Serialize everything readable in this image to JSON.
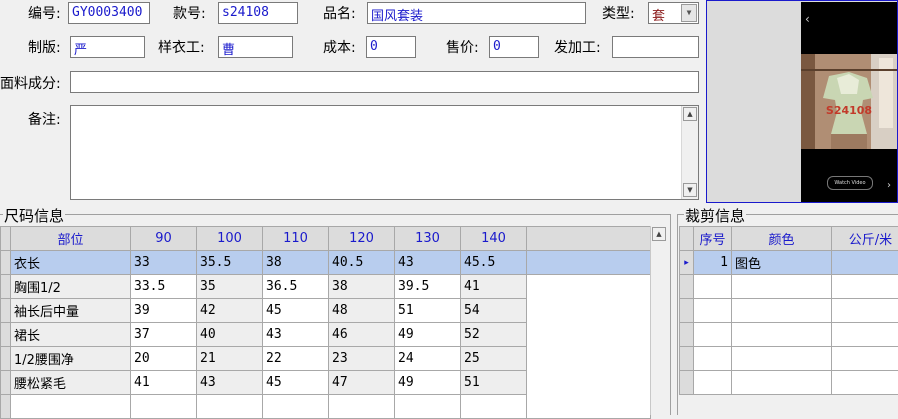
{
  "form": {
    "code_label": "编号:",
    "code_value": "GY0003400",
    "style_label": "款号:",
    "style_value": "s24108",
    "name_label": "品名:",
    "name_value": "国风套装",
    "type_label": "类型:",
    "type_value": "套",
    "pattern_label": "制版:",
    "pattern_value": "严",
    "sample_label": "样衣工:",
    "sample_value": "曹",
    "cost_label": "成本:",
    "cost_value": "0",
    "price_label": "售价:",
    "price_value": "0",
    "process_label": "发加工:",
    "process_value": "",
    "fabric_label": "面料成分:",
    "fabric_value": "",
    "remark_label": "备注:",
    "remark_value": ""
  },
  "preview": {
    "overlay_text": "S24108",
    "button_text": "Watch Video",
    "left_arrow": "‹",
    "right_arrow": "›"
  },
  "size_panel": {
    "title": "尺码信息",
    "headers": [
      "部位",
      "90",
      "100",
      "110",
      "120",
      "130",
      "140"
    ],
    "rows": [
      [
        "衣长",
        "33",
        "35.5",
        "38",
        "40.5",
        "43",
        "45.5"
      ],
      [
        "胸围1/2",
        "33.5",
        "35",
        "36.5",
        "38",
        "39.5",
        "41"
      ],
      [
        "袖长后中量",
        "39",
        "42",
        "45",
        "48",
        "51",
        "54"
      ],
      [
        "裙长",
        "37",
        "40",
        "43",
        "46",
        "49",
        "52"
      ],
      [
        "1/2腰围净",
        "20",
        "21",
        "22",
        "23",
        "24",
        "25"
      ],
      [
        "腰松紧毛",
        "41",
        "43",
        "45",
        "47",
        "49",
        "51"
      ]
    ],
    "selected_row": 0
  },
  "cut_panel": {
    "title": "裁剪信息",
    "headers": [
      "序号",
      "颜色",
      "公斤/米"
    ],
    "rows": [
      [
        "1",
        "图色",
        ""
      ]
    ],
    "current_marker": "▸"
  },
  "colors": {
    "field_text": "#1a1acc",
    "selection": "#b8cdee",
    "header_bg": "#dcdcdc"
  }
}
